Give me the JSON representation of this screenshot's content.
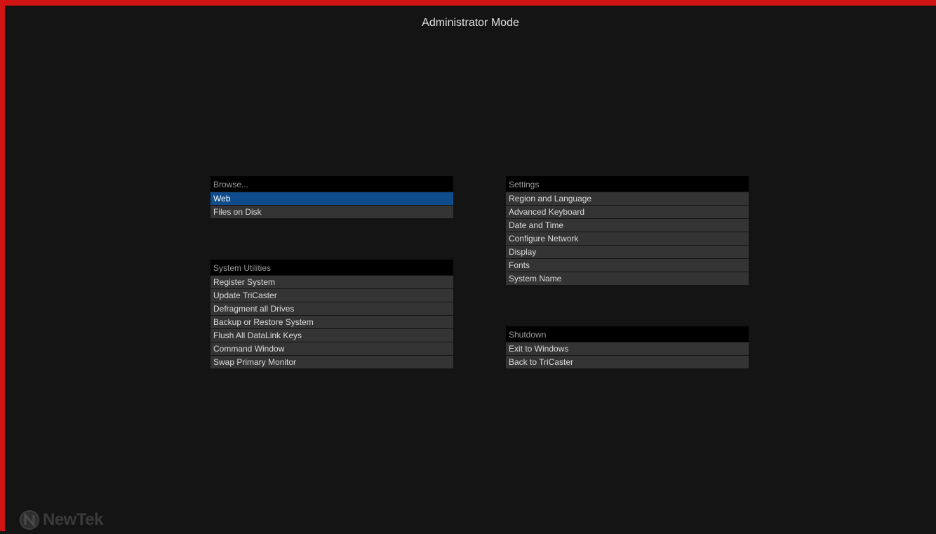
{
  "title": "Administrator Mode",
  "colors": {
    "border": "#d01414",
    "background": "#141414",
    "header": "#000000",
    "item": "#343434",
    "selected": "#0f4c8c"
  },
  "browse": {
    "header": "Browse...",
    "items": [
      {
        "label": "Web",
        "selected": true
      },
      {
        "label": "Files on Disk"
      }
    ]
  },
  "system_utilities": {
    "header": "System Utilities",
    "items": [
      {
        "label": "Register System"
      },
      {
        "label": "Update TriCaster"
      },
      {
        "label": "Defragment all Drives"
      },
      {
        "label": "Backup or Restore System"
      },
      {
        "label": "Flush All DataLink Keys"
      },
      {
        "label": "Command Window"
      },
      {
        "label": "Swap Primary Monitor"
      }
    ]
  },
  "settings": {
    "header": "Settings",
    "items": [
      {
        "label": "Region and Language"
      },
      {
        "label": "Advanced Keyboard"
      },
      {
        "label": "Date and Time"
      },
      {
        "label": "Configure Network"
      },
      {
        "label": "Display"
      },
      {
        "label": "Fonts"
      },
      {
        "label": "System Name"
      }
    ]
  },
  "shutdown": {
    "header": "Shutdown",
    "items": [
      {
        "label": "Exit to Windows"
      },
      {
        "label": "Back to TriCaster"
      }
    ]
  },
  "logo": {
    "text": "NewTek",
    "icon": "newtek-logo-icon"
  }
}
